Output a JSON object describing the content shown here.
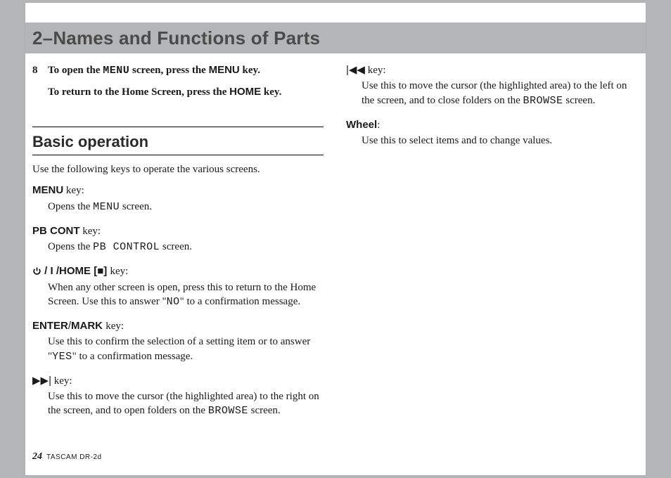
{
  "title": "2–Names and Functions of Parts",
  "step8": {
    "num": "8",
    "line1_a": "To open the ",
    "line1_menu_lcd": "MENU",
    "line1_b": " screen, press the ",
    "line1_menu_key": "MENU",
    "line1_c": " key.",
    "line2_a": "To return to the Home Screen, press the ",
    "line2_home_key": "HOME",
    "line2_b": " key."
  },
  "section": {
    "heading": "Basic operation",
    "intro": "Use the following keys to operate the various screens."
  },
  "keys": {
    "menu": {
      "label": "MENU",
      "suffix": " key:",
      "desc_a": "Opens the ",
      "desc_menu_lcd": "MENU",
      "desc_b": " screen."
    },
    "pbcont": {
      "label": "PB CONT",
      "suffix": " key:",
      "desc_a": "Opens the ",
      "desc_lcd": "PB CONTROL",
      "desc_b": " screen."
    },
    "home": {
      "slash": "/",
      "label": "HOME [",
      "stop": "■",
      "label_end": "]",
      "suffix": " key:",
      "desc_a": "When any other screen is open, press this to return to the Home Screen. Use this to answer \"",
      "desc_no": "NO",
      "desc_b": "\" to a confirmation message."
    },
    "enter": {
      "label_a": "ENTER",
      "slash": "/",
      "label_b": "MARK",
      "suffix": " key:",
      "desc_a": "Use this to confirm the selection of a setting item or to answer \"",
      "desc_yes": "YES",
      "desc_b": "\" to a confirmation message."
    },
    "ffwd": {
      "arrow": "▶▶|",
      "suffix": " key:",
      "desc_a": "Use this to move the cursor (the highlighted area) to the right on the screen, and to open folders on the ",
      "desc_lcd": "BROWSE",
      "desc_b": " screen."
    },
    "rew": {
      "arrow": "|◀◀",
      "suffix": " key:",
      "desc_a": "Use this to move the cursor (the highlighted area) to the left on the screen, and to close folders on the ",
      "desc_lcd": "BROWSE",
      "desc_b": " screen."
    },
    "wheel": {
      "label": "Wheel",
      "suffix": ":",
      "desc": "Use this to select items and to change values."
    }
  },
  "footer": {
    "page": "24",
    "product": "TASCAM  DR-2d"
  }
}
